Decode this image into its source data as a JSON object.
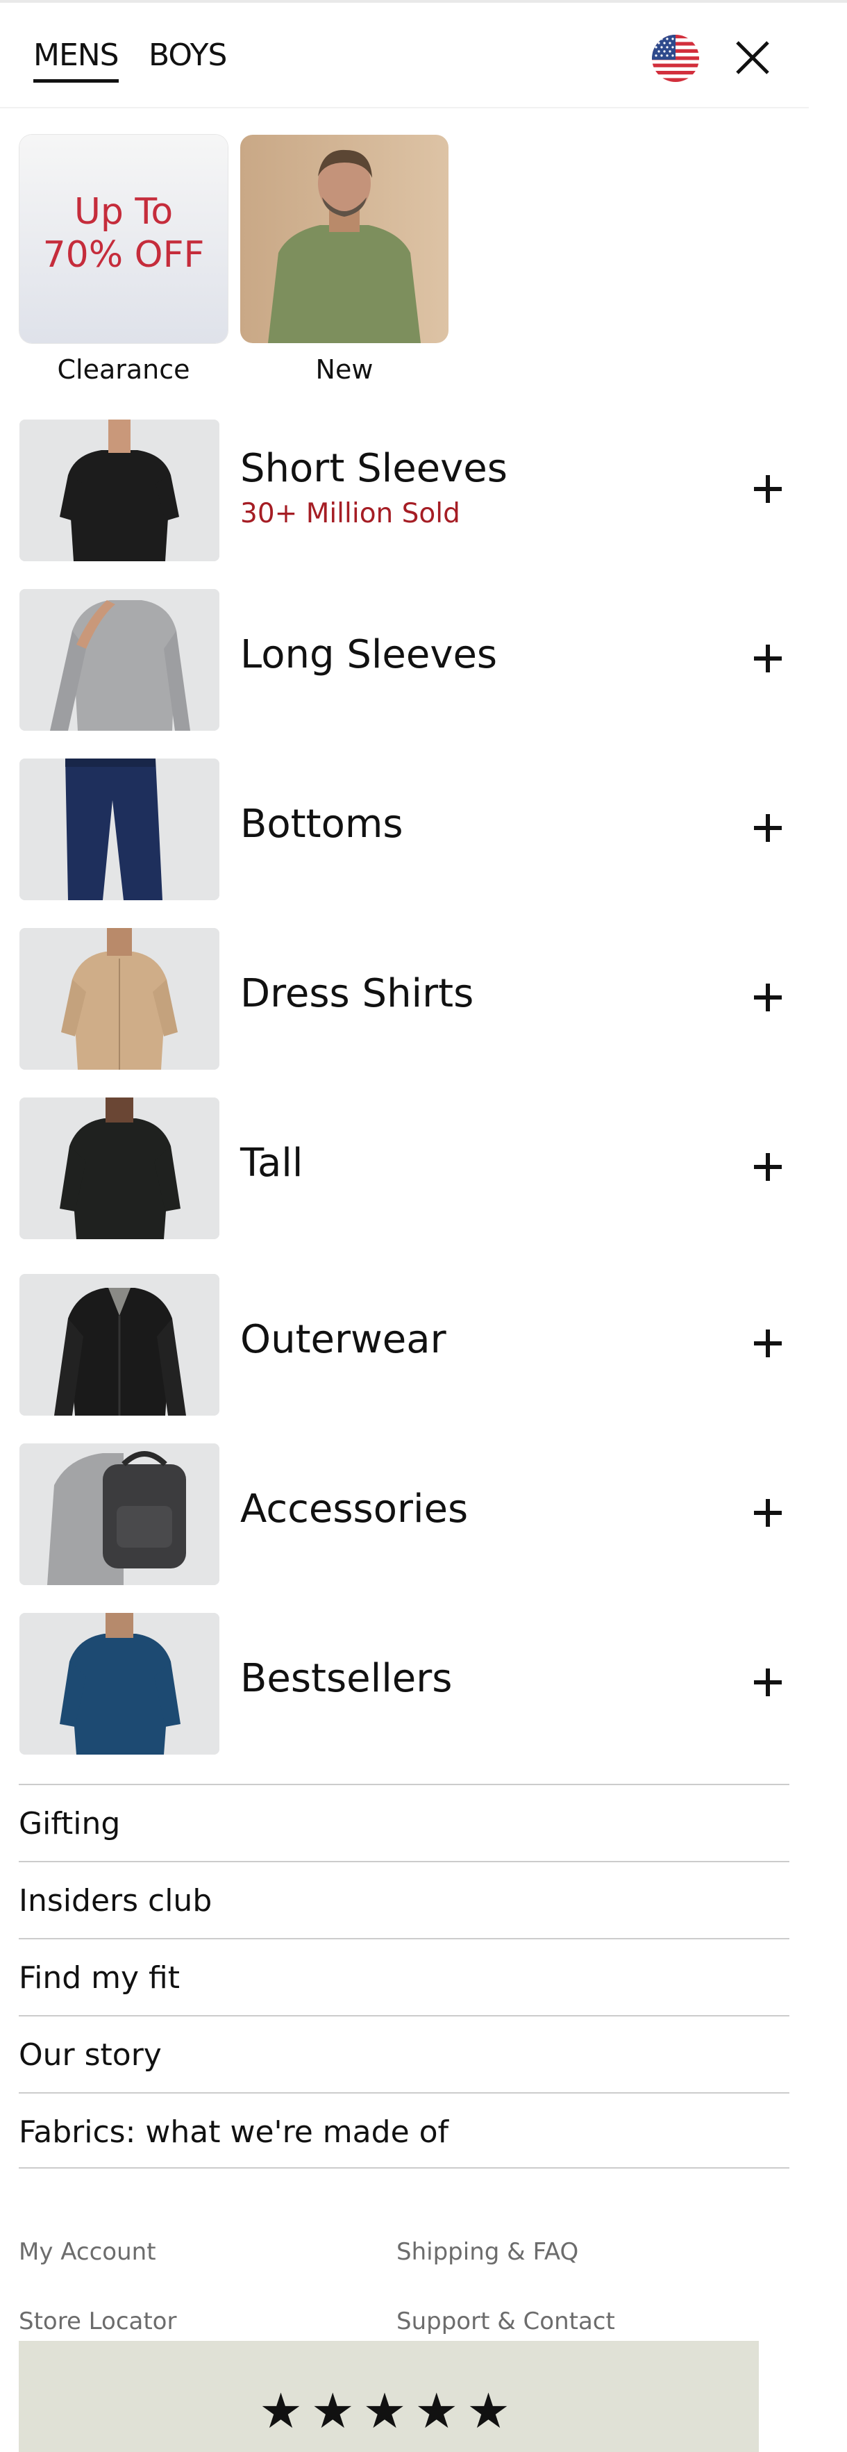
{
  "header": {
    "tabs": [
      "MENS",
      "BOYS"
    ],
    "active_tab": "MENS",
    "flag_icon": "us-flag-icon",
    "close_icon": "close-icon"
  },
  "promos": [
    {
      "label": "Clearance",
      "text_line1": "Up To",
      "text_line2": "70% OFF",
      "text_color": "#c52c3b"
    },
    {
      "label": "New"
    }
  ],
  "categories": [
    {
      "name": "Short Sleeves",
      "sub": "30+ Million Sold"
    },
    {
      "name": "Long Sleeves"
    },
    {
      "name": "Bottoms"
    },
    {
      "name": "Dress Shirts"
    },
    {
      "name": "Tall"
    },
    {
      "name": "Outerwear"
    },
    {
      "name": "Accessories"
    },
    {
      "name": "Bestsellers"
    }
  ],
  "links": [
    "Gifting",
    "Insiders club",
    "Find my fit",
    "Our story",
    "Fabrics: what we're made of"
  ],
  "footer": {
    "links": [
      "My Account",
      "Shipping & FAQ",
      "Store Locator",
      "Support & Contact"
    ],
    "stars": "★★★★★",
    "rating_stars": 5
  },
  "colors": {
    "sale_red": "#c52c3b",
    "subtitle_red": "#a51d24",
    "reviews_bg": "#e0e1d6"
  }
}
